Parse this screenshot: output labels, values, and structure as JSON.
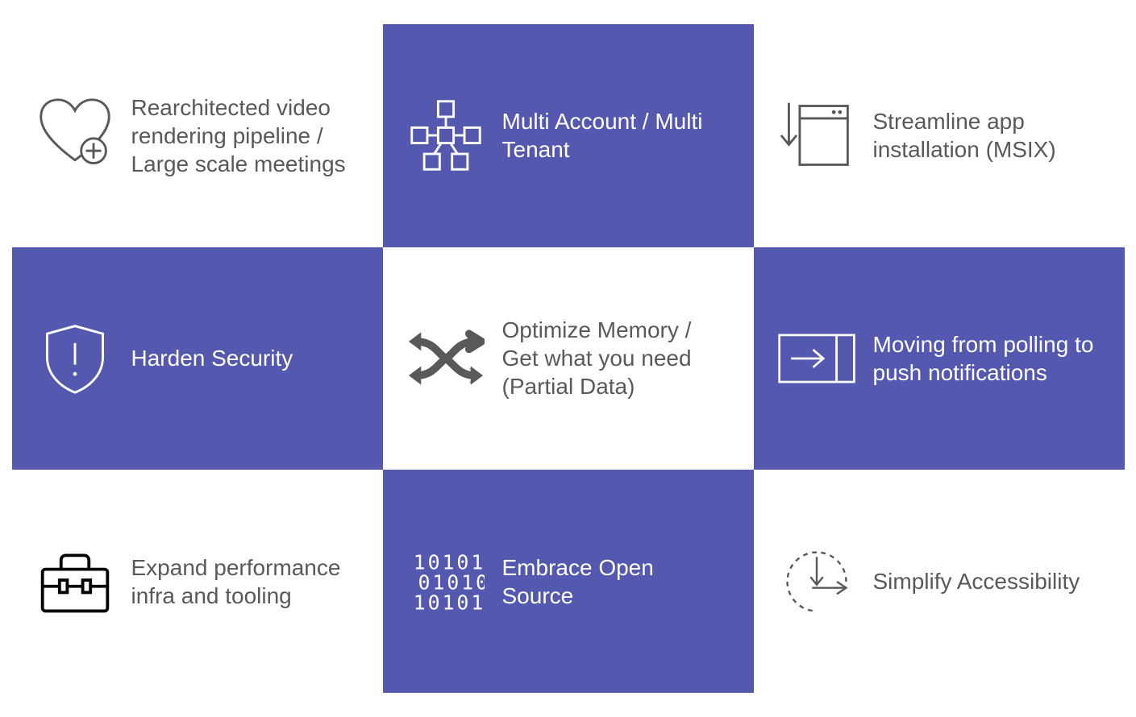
{
  "colors": {
    "accent": "#5558af",
    "text_dark": "#595959",
    "white": "#ffffff"
  },
  "tiles": [
    {
      "variant": "white",
      "icon": "heart-plus-icon",
      "label": "Rearchitected video rendering pipeline / Large scale meetings"
    },
    {
      "variant": "blue",
      "icon": "hierarchy-icon",
      "label": "Multi Account / Multi Tenant"
    },
    {
      "variant": "white",
      "icon": "install-box-icon",
      "label": "Streamline app installation (MSIX)"
    },
    {
      "variant": "blue",
      "icon": "shield-alert-icon",
      "label": "Harden Security"
    },
    {
      "variant": "white",
      "icon": "shuffle-icon",
      "label": "Optimize Memory / Get what you need (Partial Data)"
    },
    {
      "variant": "blue",
      "icon": "arrow-right-box-icon",
      "label": "Moving from polling to push notifications"
    },
    {
      "variant": "white",
      "icon": "toolbox-icon",
      "label": "Expand performance infra and tooling"
    },
    {
      "variant": "blue",
      "icon": "binary-icon",
      "label": "Embrace Open Source"
    },
    {
      "variant": "white",
      "icon": "accessibility-arrows-icon",
      "label": "Simplify Accessibility"
    }
  ]
}
